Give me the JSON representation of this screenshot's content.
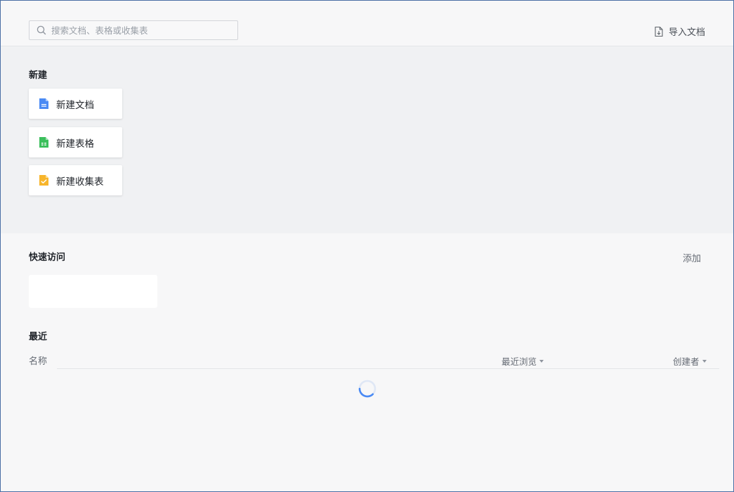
{
  "search": {
    "placeholder": "搜索文档、表格或收集表",
    "icon": "search-icon"
  },
  "header": {
    "import_label": "导入文档",
    "import_icon": "import-doc-icon"
  },
  "new_section": {
    "title": "新建",
    "items": [
      {
        "label": "新建文档",
        "icon": "doc-icon",
        "color": "#4a8af4"
      },
      {
        "label": "新建表格",
        "icon": "sheet-icon",
        "color": "#3bbf5c"
      },
      {
        "label": "新建收集表",
        "icon": "form-icon",
        "color": "#f7b52c"
      }
    ]
  },
  "quick_access": {
    "title": "快速访问",
    "add_label": "添加"
  },
  "recent": {
    "title": "最近",
    "columns": {
      "name": "名称",
      "recent_view": "最近浏览",
      "creator": "创建者"
    }
  },
  "colors": {
    "accent": "#4a8af4",
    "window_border": "#4a6fa5"
  }
}
